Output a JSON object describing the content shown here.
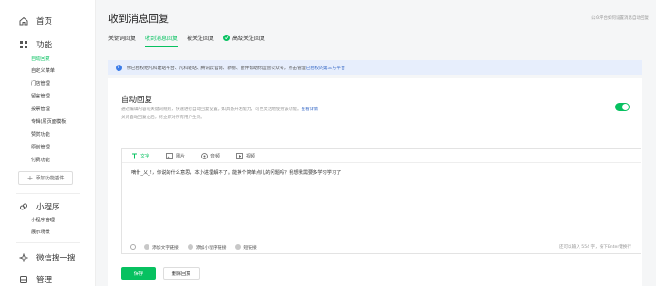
{
  "sidebar": {
    "home": {
      "label": "首页",
      "icon": "home-icon"
    },
    "features": {
      "label": "功能",
      "icon": "grid-icon",
      "items": [
        {
          "label": "自动回复",
          "active": true
        },
        {
          "label": "自定义菜单",
          "active": false
        },
        {
          "label": "门店管理",
          "active": false
        },
        {
          "label": "留言管理",
          "active": false
        },
        {
          "label": "投票管理",
          "active": false
        },
        {
          "label": "专辑(原页面模板)",
          "active": false
        },
        {
          "label": "赞赏功能",
          "active": false
        },
        {
          "label": "原创管理",
          "active": false
        },
        {
          "label": "付费功能",
          "active": false
        }
      ],
      "add_plugin_label": "添加功能插件"
    },
    "mini_program": {
      "label": "小程序",
      "icon": "mini-program-icon",
      "items": [
        {
          "label": "小程序管理"
        },
        {
          "label": "展示场景"
        }
      ]
    },
    "wechat_search": {
      "label": "微信搜一搜",
      "icon": "search-spark-icon"
    },
    "manage": {
      "label": "管理",
      "icon": "manage-icon"
    }
  },
  "header": {
    "title": "收到消息回复",
    "right_note": "公众平台如何设置消息自动回复"
  },
  "tabs": [
    {
      "label": "关键词回复",
      "active": false
    },
    {
      "label": "收到消息回复",
      "active": true
    },
    {
      "label": "被关注回复",
      "active": false
    },
    {
      "label": "高级关注回复",
      "active": false,
      "badge": true
    }
  ],
  "notice": {
    "text": "你已授权给凡科建站平台、凡科轻站、腾讯云官网、新榜、壹伴帮助你运营公众号，点击管理",
    "link": "已授权的第三方平台"
  },
  "panel": {
    "title": "自动回复",
    "desc_line1": "通过编辑内容或关键词规则，快速进行自动回复设置。如具备开发能力，可更灵活地使用该功能。",
    "desc_link": "查看详情",
    "desc_line2": "关闭自动回复之后，将立即对所有用户生效。",
    "toggle_on": true,
    "editor": {
      "tools": [
        {
          "label": "文字",
          "icon": "text-icon",
          "active": true
        },
        {
          "label": "图片",
          "icon": "image-icon",
          "active": false
        },
        {
          "label": "音频",
          "icon": "audio-icon",
          "active": false
        },
        {
          "label": "视频",
          "icon": "video-icon",
          "active": false
        }
      ],
      "content": "嘀什_乂_!，你说的什么意思，本小进理解不了。能换个简单点儿的问题吗？我想我需要多学习学习了",
      "bottom": [
        {
          "label": "添加文字链接"
        },
        {
          "label": "添加小程序链接"
        },
        {
          "label": "短链接"
        }
      ],
      "char_count": "还可以输入 554 字，按下Enter键换行"
    },
    "save_label": "保存",
    "delete_label": "删除回复"
  },
  "colors": {
    "accent": "#07c160",
    "notice_bg": "#e7eefc",
    "link": "#3b6cc7"
  }
}
